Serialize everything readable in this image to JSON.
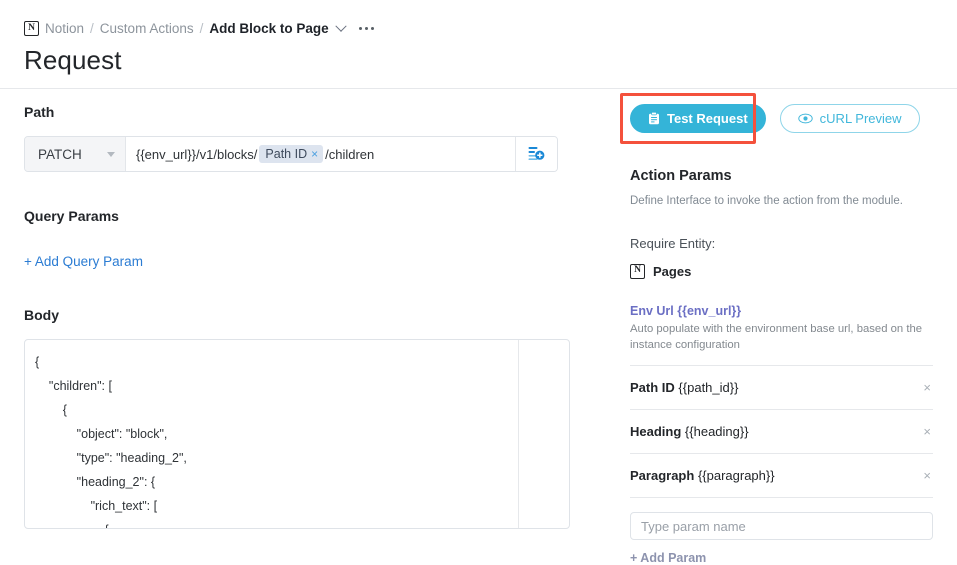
{
  "breadcrumb": {
    "logo_letter": "N",
    "root": "Notion",
    "sep1": "/",
    "section": "Custom Actions",
    "sep2": "/",
    "current": "Add Block to Page"
  },
  "page_title": "Request",
  "left": {
    "path_label": "Path",
    "method": "PATCH",
    "path_prefix": "{{env_url}}/v1/blocks/",
    "path_chip": "Path ID",
    "path_chip_close": "×",
    "path_suffix": "/children",
    "query_params_label": "Query Params",
    "add_query_param": "+ Add Query Param",
    "body_label": "Body",
    "body_code": "{\n    \"children\": [\n        {\n            \"object\": \"block\",\n            \"type\": \"heading_2\",\n            \"heading_2\": {\n                \"rich_text\": [\n                    {"
  },
  "right": {
    "test_request_button": "Test Request",
    "curl_preview_button": "cURL Preview",
    "action_params_title": "Action Params",
    "action_params_sub": "Define Interface to invoke the action from the module.",
    "require_entity_label": "Require Entity:",
    "entity_name": "Pages",
    "entity_logo_letter": "N",
    "env_url_title": "Env Url {{env_url}}",
    "env_url_desc": "Auto populate with the environment base url, based on the instance configuration",
    "params": [
      {
        "name": "Path ID",
        "var": "{{path_id}}",
        "close": "×"
      },
      {
        "name": "Heading",
        "var": "{{heading}}",
        "close": "×"
      },
      {
        "name": "Paragraph",
        "var": "{{paragraph}}",
        "close": "×"
      }
    ],
    "param_input_placeholder": "Type param name",
    "param_input_value": "",
    "add_param": "+ Add Param"
  },
  "colors": {
    "accent_teal": "#34b4d8",
    "link_blue": "#2b7cd3",
    "highlight_red": "#f4513c",
    "env_purple": "#6b6fc4"
  }
}
